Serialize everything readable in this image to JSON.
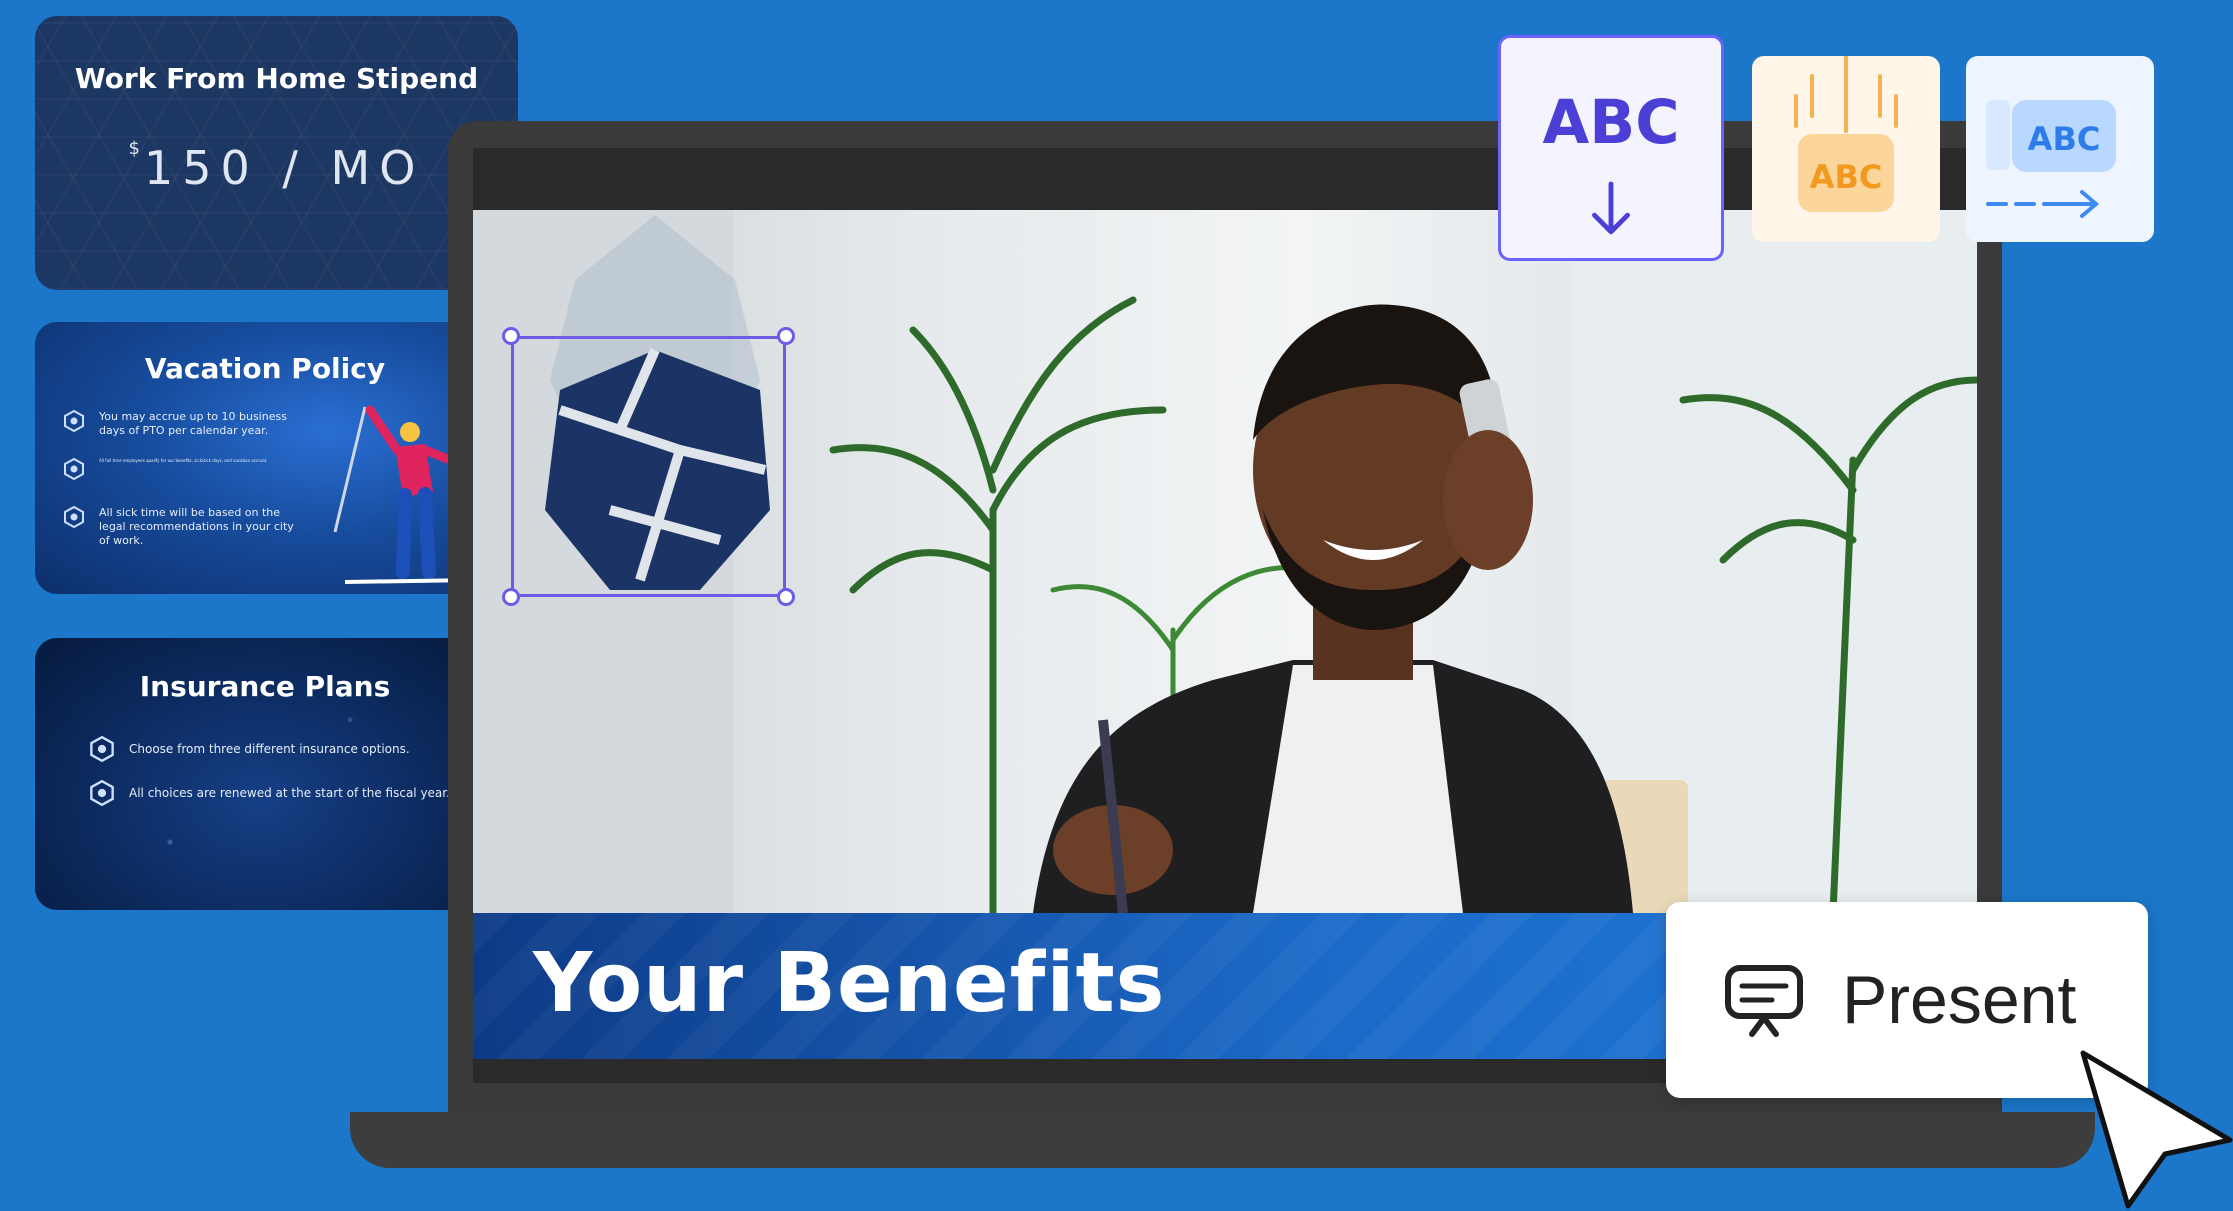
{
  "colors": {
    "background": "#1c76c9",
    "accent_purple": "#6c5ce7",
    "laptop": "#3a3a3a"
  },
  "thumbnails": [
    {
      "title": "Work From Home Stipend",
      "amount_symbol": "$",
      "amount": "150 / MO"
    },
    {
      "title": "Vacation Policy",
      "bullets": [
        "You may accrue up to 10 business days of PTO per calendar year.",
        "All full time employees qualify for our benefits, sick/sick days, and vacation accrual.",
        "All sick time will be based on the legal recommendations in your city of work."
      ]
    },
    {
      "title": "Insurance Plans",
      "bullets": [
        "Choose from three different insurance options.",
        "All choices are renewed at the start of the fiscal year."
      ]
    }
  ],
  "slide": {
    "banner_title": "Your Benefits",
    "logo_selected": true
  },
  "animations": [
    {
      "label": "ABC",
      "icon": "arrow-down-icon",
      "selected": true
    },
    {
      "label": "ABC",
      "icon": "drop-in-icon",
      "selected": false
    },
    {
      "label": "ABC",
      "icon": "slide-right-icon",
      "selected": false
    }
  ],
  "present_button": {
    "label": "Present",
    "icon": "present-icon"
  }
}
